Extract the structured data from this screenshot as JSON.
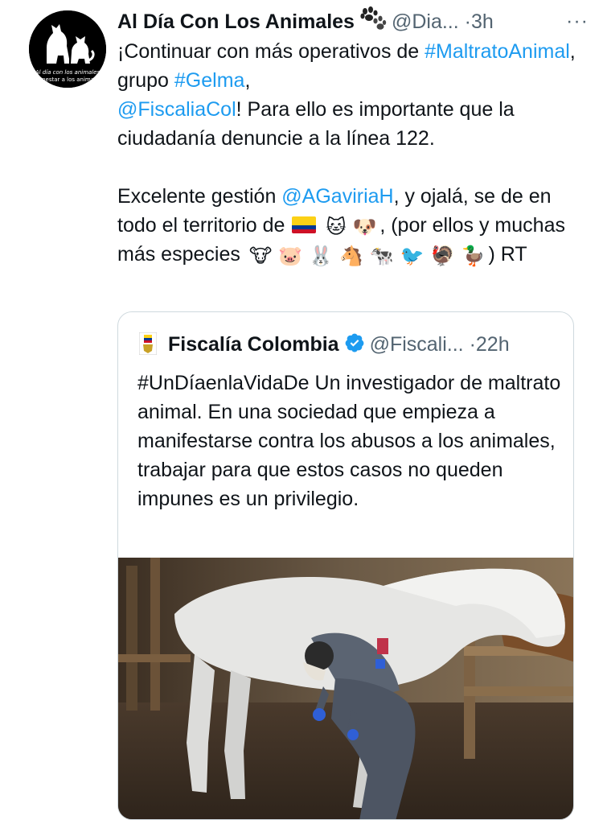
{
  "tweet": {
    "display_name": "Al Día Con Los Animales",
    "handle": "@Dia...",
    "separator": "·",
    "time": "3h",
    "more": "···",
    "paw_icon": "paw-prints-icon",
    "avatar": {
      "line1": "Al día con los animales",
      "line2": "Bienestar a los animales"
    },
    "paragraph1": {
      "part1": "¡Continuar con más operativos de ",
      "hashtag1": "#MaltratoAnimal",
      "part2": ", grupo ",
      "hashtag2": "#Gelma",
      "part3": ",",
      "mention1": "@FiscaliaCol",
      "part4": "! Para ello es importante que la ciudadanía denuncie a la línea 122."
    },
    "paragraph2": {
      "part1": "Excelente gestión ",
      "mention": "@AGaviriaH",
      "part2": ", y ojalá, se de en todo el territorio de",
      "part3": ", (por ellos y muchas más especies",
      "part4": ") RT",
      "emojis_group1": [
        "🐱",
        "🐶"
      ],
      "emojis_group2": [
        "🐮",
        "🐷",
        "🐰",
        "🐴",
        "🐄",
        "🐦"
      ],
      "emojis_group3": [
        "🦃",
        "🦆"
      ],
      "flag": "colombia-flag"
    }
  },
  "quote": {
    "display_name": "Fiscalía Colombia",
    "handle": "@Fiscali...",
    "separator": "·",
    "time": "22h",
    "verified_icon": "verified-badge-icon",
    "text": "#UnDíaenlaVidaDe Un investigador de maltrato animal. En una sociedad que empieza a manifestarse contra los abusos a los animales, trabajar para que estos casos no queden impunes es un privilegio."
  },
  "colors": {
    "link": "#1d9bf0",
    "text": "#0f1419",
    "secondary": "#536471",
    "border": "#cfd9de"
  }
}
